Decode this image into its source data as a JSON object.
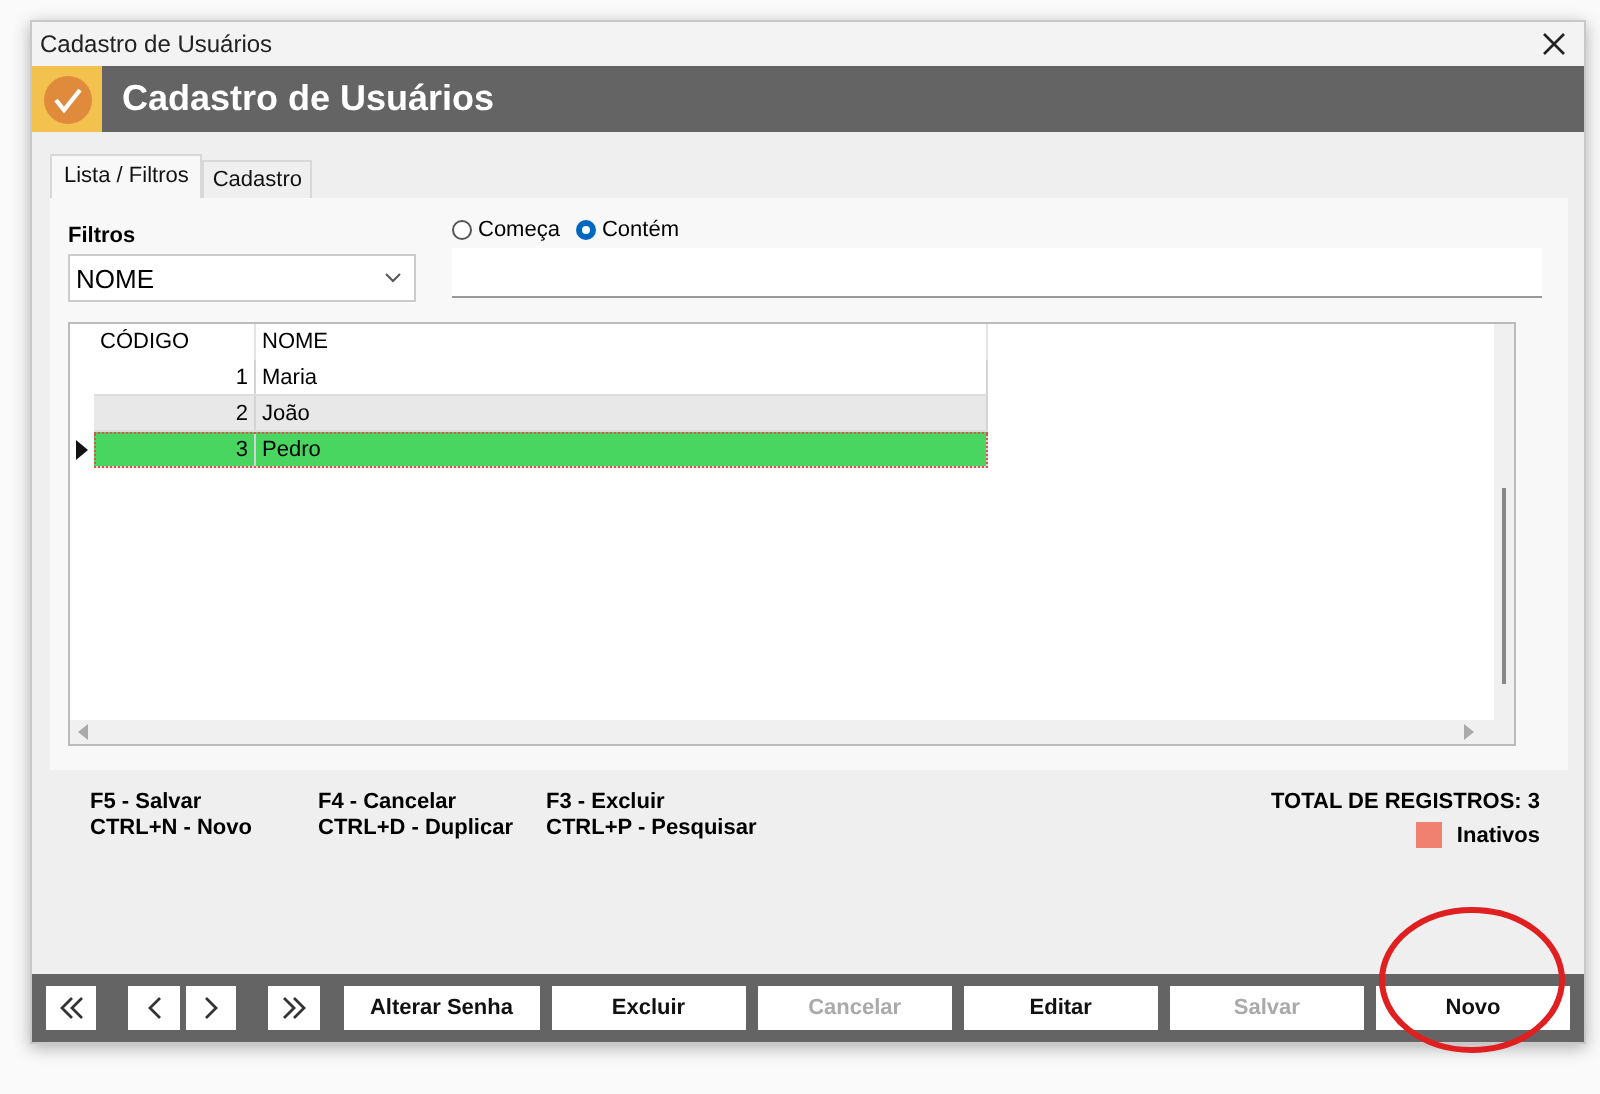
{
  "window": {
    "title": "Cadastro de Usuários"
  },
  "header": {
    "title": "Cadastro de Usuários"
  },
  "tabs": [
    {
      "label": "Lista / Filtros",
      "selected": true
    },
    {
      "label": "Cadastro",
      "selected": false
    }
  ],
  "filters": {
    "label": "Filtros",
    "field": "NOME",
    "options": [
      {
        "label": "Começa",
        "selected": false
      },
      {
        "label": "Contém",
        "selected": true
      }
    ]
  },
  "table": {
    "columns": [
      "CÓDIGO",
      "NOME"
    ],
    "rows": [
      {
        "code": "1",
        "name": "Maria",
        "selected": false
      },
      {
        "code": "2",
        "name": "João",
        "selected": false
      },
      {
        "code": "3",
        "name": "Pedro",
        "selected": true
      }
    ]
  },
  "shortcuts": [
    [
      "F5 - Salvar",
      "CTRL+N - Novo"
    ],
    [
      "F4 - Cancelar",
      "CTRL+D - Duplicar"
    ],
    [
      "F3 - Excluir",
      "CTRL+P - Pesquisar"
    ]
  ],
  "total": "TOTAL DE REGISTROS: 3",
  "legend": [
    {
      "label": "Inativos",
      "color": "#f08070"
    }
  ],
  "nav_buttons": [
    {
      "kind": "first"
    },
    {
      "kind": "prev"
    },
    {
      "kind": "next"
    },
    {
      "kind": "last"
    }
  ],
  "buttons": [
    {
      "label": "Alterar Senha",
      "disabled": false
    },
    {
      "label": "Excluir",
      "disabled": false
    },
    {
      "label": "Cancelar",
      "disabled": true
    },
    {
      "label": "Editar",
      "disabled": false
    },
    {
      "label": "Salvar",
      "disabled": true
    },
    {
      "label": "Novo",
      "disabled": false,
      "circled": true
    }
  ]
}
